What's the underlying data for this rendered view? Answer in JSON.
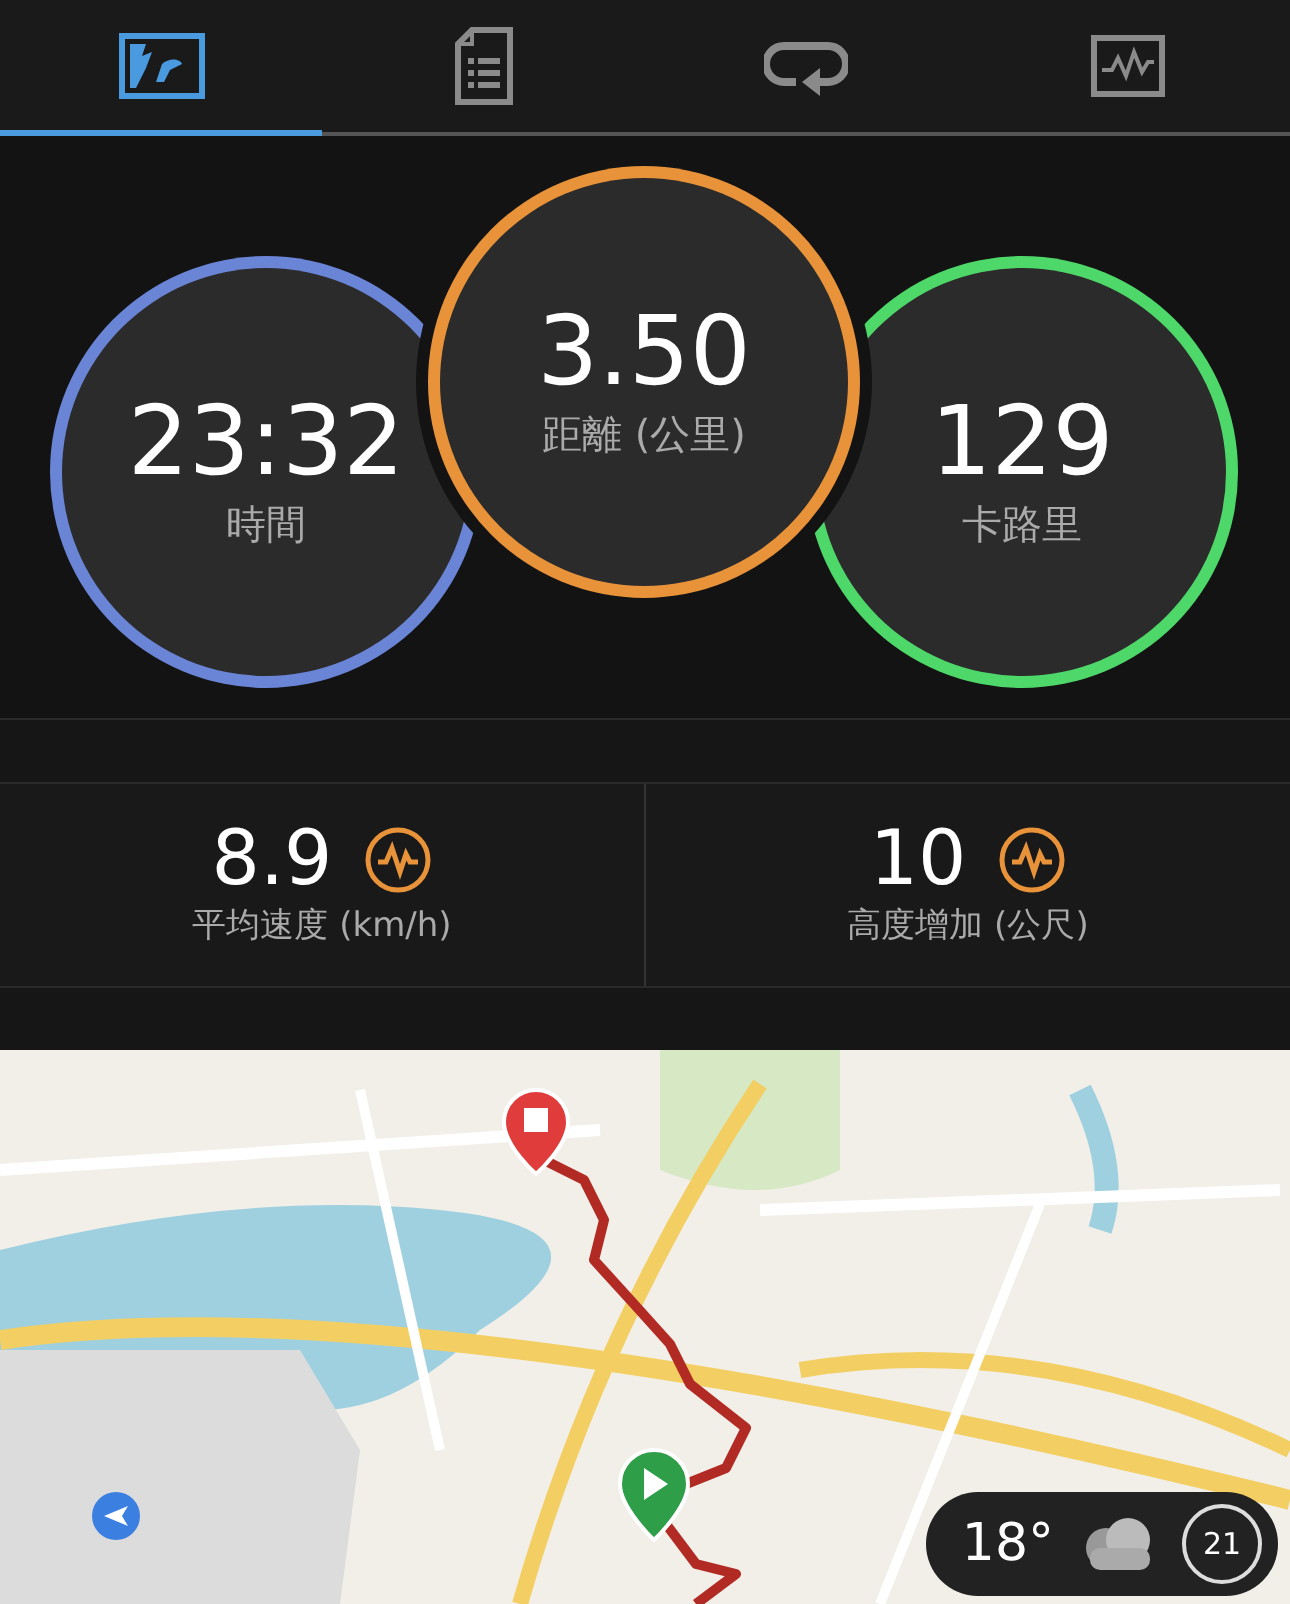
{
  "tabs": [
    {
      "kind": "overview",
      "selected": true
    },
    {
      "kind": "laps",
      "selected": false
    },
    {
      "kind": "splits",
      "selected": false
    },
    {
      "kind": "charts",
      "selected": false
    }
  ],
  "rings": [
    {
      "value": "23:32",
      "label": "時間",
      "color": "#6a84d6"
    },
    {
      "value": "3.50",
      "label": "距離 (公里)",
      "color": "#e8923a"
    },
    {
      "value": "129",
      "label": "卡路里",
      "color": "#4fd86a"
    }
  ],
  "stats": [
    {
      "value": "8.9",
      "label": "平均速度 (km/h)"
    },
    {
      "value": "10",
      "label": "高度增加 (公尺)"
    }
  ],
  "weather": {
    "temperature": "18°",
    "number": "21"
  }
}
